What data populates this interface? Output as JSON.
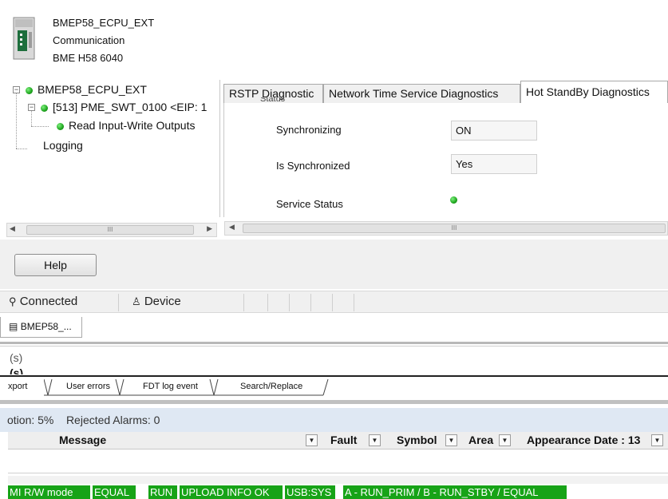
{
  "device": {
    "name": "BMEP58_ECPU_EXT",
    "category": "Communication",
    "model": "BME H58 6040",
    "icon": "plc-device-icon"
  },
  "tree": {
    "root_label": "BMEP58_ECPU_EXT",
    "child_label": "[513] PME_SWT_0100 <EIP: 1",
    "grandchild_label": "Read Input-Write Outputs",
    "logging_label": "Logging",
    "status_color": "#1ea51e"
  },
  "tabs": [
    {
      "label": "RSTP Diagnostic"
    },
    {
      "label": "Network Time Service Diagnostics"
    },
    {
      "label": "Hot StandBy Diagnostics"
    }
  ],
  "diagnostics": {
    "section_label": "Status",
    "synchronizing_label": "Synchronizing",
    "synchronizing_value": "ON",
    "is_synchronized_label": "Is Synchronized",
    "is_synchronized_value": "Yes",
    "service_status_label": "Service Status"
  },
  "scroll_grip": "III",
  "help_button": "Help",
  "connection_bar": {
    "connected_label": "Connected",
    "device_label": "Device"
  },
  "document_tab": "BMEP58_...",
  "output_cut": {
    "line1": "(s)",
    "line2": "(s)"
  },
  "bottom_tabs": [
    "xport",
    "User errors",
    "FDT log event",
    "Search/Replace"
  ],
  "alarms": {
    "summary_prefix": "otion: 5%",
    "rejected": "Rejected Alarms: 0"
  },
  "alarm_columns": [
    "Message",
    "Fault",
    "Symbol",
    "Area",
    "Appearance Date : 13"
  ],
  "plc_status": {
    "chips": [
      "MI R/W mode",
      "EQUAL",
      "RUN",
      "UPLOAD INFO OK",
      "USB:SYS",
      "A - RUN_PRIM / B - RUN_STBY / EQUAL"
    ],
    "chip_color": "#17a317"
  }
}
